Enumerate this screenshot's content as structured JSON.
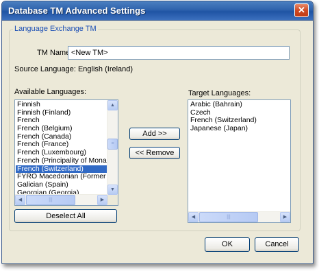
{
  "window": {
    "title": "Database TM Advanced Settings",
    "close_glyph": "✕"
  },
  "group": {
    "legend": "Language Exchange TM"
  },
  "tm_name": {
    "label": "TM Name:",
    "value": "<New TM>"
  },
  "source_language": {
    "text": "Source Language: English (Ireland)"
  },
  "available": {
    "label": "Available Languages:",
    "items": [
      "Finnish",
      "Finnish (Finland)",
      "French",
      "French (Belgium)",
      "French (Canada)",
      "French (France)",
      "French (Luxembourg)",
      "French (Principality of Monaco)",
      "French (Switzerland)",
      "FYRO Macedonian (Former Yugoslav",
      "Galician (Spain)",
      "Georgian (Georgia)"
    ],
    "selected_index": 8
  },
  "target": {
    "label": "Target Languages:",
    "items": [
      "Arabic (Bahrain)",
      "Czech",
      "French (Switzerland)",
      "Japanese (Japan)"
    ]
  },
  "buttons": {
    "add": "Add >>",
    "remove": "<< Remove",
    "deselect_all": "Deselect All",
    "ok": "OK",
    "cancel": "Cancel"
  },
  "scroll": {
    "up": "▲",
    "down": "▼",
    "left": "◀",
    "right": "▶",
    "grip_v": "≡",
    "grip_h": "|||"
  },
  "colors": {
    "title_bar": "#2f63ad",
    "selection": "#316ac5",
    "group_legend": "#1b4fb5"
  }
}
